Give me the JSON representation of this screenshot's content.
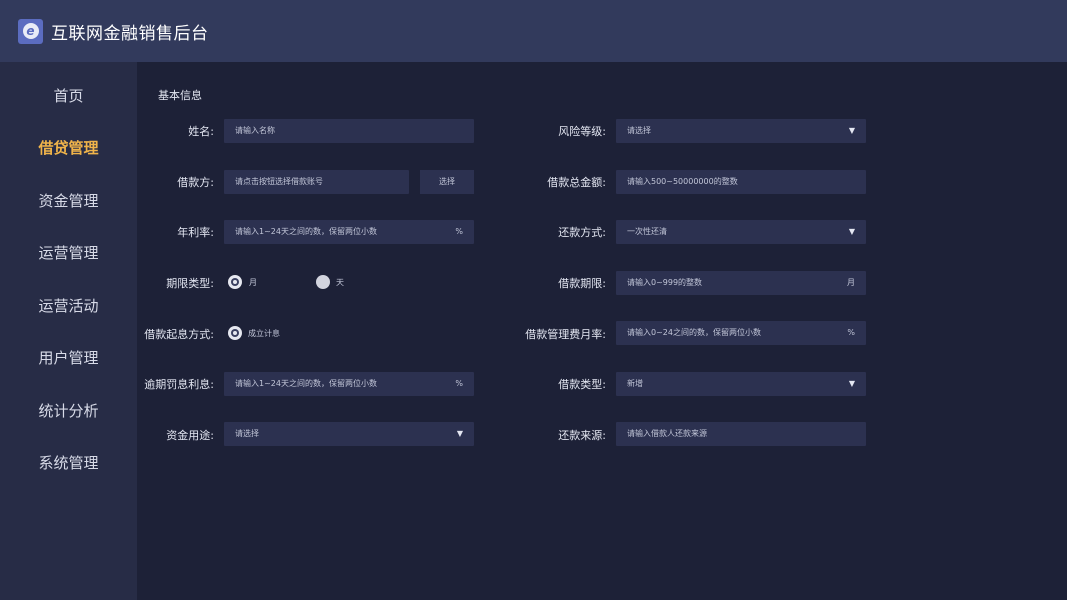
{
  "app": {
    "title": "互联网金融销售后台",
    "logo_glyph": "e"
  },
  "colors": {
    "header": "#323a5c",
    "sidebar": "#272c46",
    "background": "#1d2137",
    "field": "#2c3150",
    "active_nav": "#f0b44a"
  },
  "sidebar": {
    "items": [
      {
        "label": "首页",
        "active": false
      },
      {
        "label": "借贷管理",
        "active": true
      },
      {
        "label": "资金管理",
        "active": false
      },
      {
        "label": "运营管理",
        "active": false
      },
      {
        "label": "运营活动",
        "active": false
      },
      {
        "label": "用户管理",
        "active": false
      },
      {
        "label": "统计分析",
        "active": false
      },
      {
        "label": "系统管理",
        "active": false
      }
    ]
  },
  "form": {
    "section_title": "基本信息",
    "name": {
      "label": "姓名:",
      "placeholder": "请输入名称"
    },
    "risk_level": {
      "label": "风险等级:",
      "value": "请选择",
      "arrow": "▼"
    },
    "borrower": {
      "label": "借款方:",
      "placeholder": "请点击按钮选择借款账号",
      "button": "选择"
    },
    "total_amount": {
      "label": "借款总金额:",
      "placeholder": "请输入500~50000000的整数"
    },
    "annual_rate": {
      "label": "年利率:",
      "placeholder": "请输入1~24天之间的数，保留两位小数",
      "suffix": "%"
    },
    "repay_method": {
      "label": "还款方式:",
      "value": "一次性还清",
      "arrow": "▼"
    },
    "term_type": {
      "label": "期限类型:",
      "options": [
        "月",
        "天"
      ],
      "selected": "月"
    },
    "loan_term": {
      "label": "借款期限:",
      "placeholder": "请输入0~999的整数",
      "suffix": "月"
    },
    "interest_start": {
      "label": "借款起息方式:",
      "options": [
        "成立计息"
      ],
      "selected": "成立计息"
    },
    "mgmt_fee_rate": {
      "label": "借款管理费月率:",
      "placeholder": "请输入0~24之间的数，保留两位小数",
      "suffix": "%"
    },
    "overdue_rate": {
      "label": "逾期罚息利息:",
      "placeholder": "请输入1~24天之间的数，保留两位小数",
      "suffix": "%"
    },
    "loan_type": {
      "label": "借款类型:",
      "value": "新增",
      "arrow": "▼"
    },
    "fund_usage": {
      "label": "资金用途:",
      "value": "请选择",
      "arrow": "▼"
    },
    "repay_source": {
      "label": "还款来源:",
      "placeholder": "请输入借款人还款来源"
    }
  }
}
